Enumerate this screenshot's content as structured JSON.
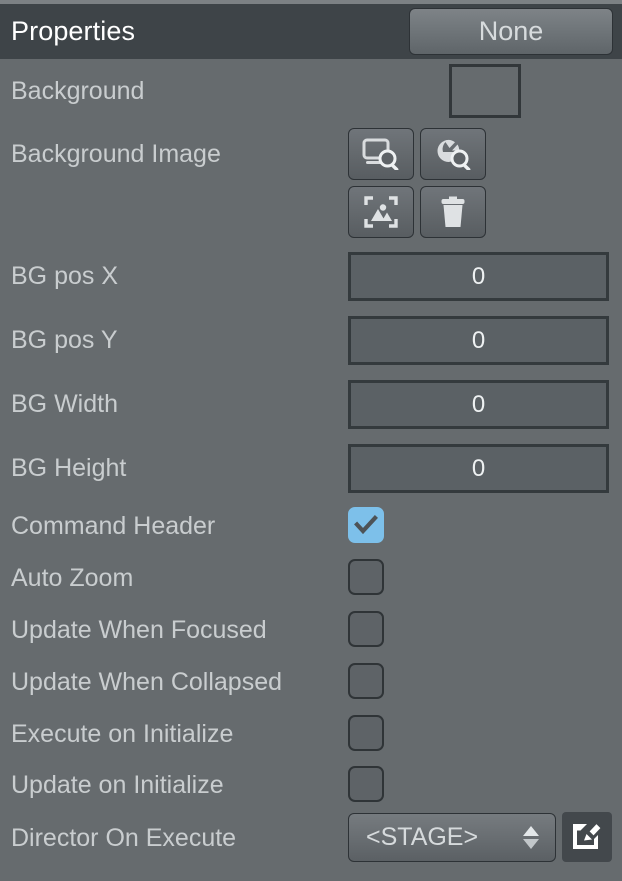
{
  "header": {
    "title": "Properties",
    "none_button_label": "None"
  },
  "rows": {
    "background": {
      "label": "Background",
      "swatch_color": "#666b6e"
    },
    "background_image": {
      "label": "Background Image",
      "buttons": [
        {
          "name": "browse-screen-icon",
          "tooltip": ""
        },
        {
          "name": "browse-web-icon",
          "tooltip": ""
        },
        {
          "name": "fit-image-icon",
          "tooltip": ""
        },
        {
          "name": "delete-icon",
          "tooltip": ""
        }
      ]
    },
    "bg_pos_x": {
      "label": "BG pos X",
      "value": "0"
    },
    "bg_pos_y": {
      "label": "BG pos Y",
      "value": "0"
    },
    "bg_width": {
      "label": "BG Width",
      "value": "0"
    },
    "bg_height": {
      "label": "BG Height",
      "value": "0"
    },
    "command_header": {
      "label": "Command Header",
      "checked": true
    },
    "auto_zoom": {
      "label": "Auto Zoom",
      "checked": false
    },
    "update_when_focused": {
      "label": "Update When Focused",
      "checked": false
    },
    "update_when_collapsed": {
      "label": "Update When Collapsed",
      "checked": false
    },
    "execute_on_initialize": {
      "label": "Execute on Initialize",
      "checked": false
    },
    "update_on_initialize": {
      "label": "Update on Initialize",
      "checked": false
    },
    "director_on_execute": {
      "label": "Director On Execute",
      "value": "<STAGE>"
    }
  },
  "colors": {
    "panel_background": "#666b6e",
    "header_background": "#3e4448",
    "label_text": "#c9cdcf",
    "checkbox_checked": "#7dc0ea",
    "field_background": "#5b6165",
    "field_border": "#343a3d"
  }
}
